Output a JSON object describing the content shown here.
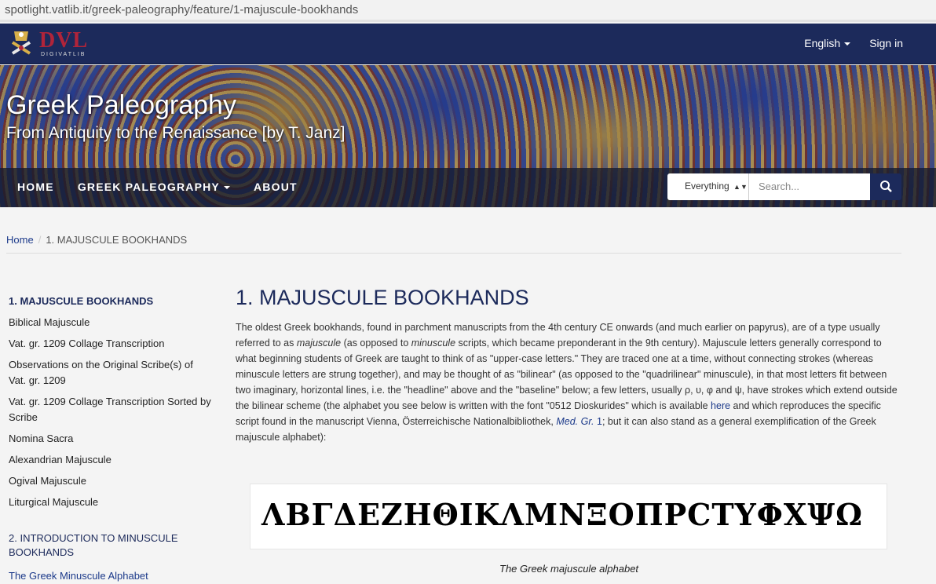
{
  "browser": {
    "url": "spotlight.vatlib.it/greek-paleography/feature/1-majuscule-bookhands"
  },
  "topnav": {
    "logo_text": "DVL",
    "logo_sub": "DIGIVATLIB",
    "language": "English",
    "sign_in": "Sign in"
  },
  "banner": {
    "title": "Greek Paleography",
    "subtitle": "From Antiquity to the Renaissance [by T. Janz]"
  },
  "mainnav": {
    "items": [
      "HOME",
      "GREEK PALEOGRAPHY",
      "ABOUT"
    ]
  },
  "search": {
    "scope": "Everything",
    "placeholder": "Search..."
  },
  "breadcrumb": {
    "home": "Home",
    "current": "1. MAJUSCULE BOOKHANDS"
  },
  "sidebar": {
    "section1": "1. MAJUSCULE BOOKHANDS",
    "items": [
      "Biblical Majuscule",
      "Vat. gr. 1209 Collage Transcription",
      "Observations on the Original Scribe(s) of Vat. gr. 1209",
      "Vat. gr. 1209 Collage Transcription Sorted by Scribe",
      "Nomina Sacra",
      "Alexandrian Majuscule",
      "Ogival Majuscule",
      "Liturgical Majuscule"
    ],
    "section2": "2. INTRODUCTION TO MINUSCULE BOOKHANDS",
    "section2_item": "The Greek Minuscule Alphabet"
  },
  "content": {
    "heading": "1. MAJUSCULE BOOKHANDS",
    "p1": "The oldest Greek bookhands, found in parchment manuscripts from the 4th century CE onwards (and much earlier on papyrus), are of a type usually referred to as ",
    "em1": "majuscule",
    "p2": " (as opposed to ",
    "em2": "minuscule",
    "p3": " scripts, which became preponderant in the 9th century). Majuscule letters generally correspond to what beginning students of Greek are taught to think of as \"upper-case letters.\" They are traced one at a time, without connecting strokes (whereas minuscule letters are strung together), and may be thought of as \"bilinear\" (as opposed to the \"quadrilinear\" minuscule), in that most letters fit between two imaginary, horizontal lines, i.e. the \"headline\" above and the \"baseline\" below; a few letters, usually ρ, υ, φ and ψ, have strokes which extend outside the bilinear scheme (the alphabet you see below is written with the font \"0512 Dioskurides\" which is available ",
    "link_here": "here",
    "p4": " and which reproduces the specific script found in the manuscript Vienna, Österreichische Nationalbibliothek, ",
    "link_med": "Med. Gr.",
    "link_num": " 1",
    "p5": "; but it can also stand as a general exemplification of the Greek majuscule alphabet):",
    "alphabet": "ΛΒΓΔΕΖΗΘΙΚΛΜΝΞΟΠΡϹΤΥΦΧΨΩ",
    "caption": "The Greek majuscule alphabet"
  },
  "colors": {
    "navy": "#1c2a5b",
    "link": "#1c3a8a",
    "logo_red": "#b0243a"
  }
}
